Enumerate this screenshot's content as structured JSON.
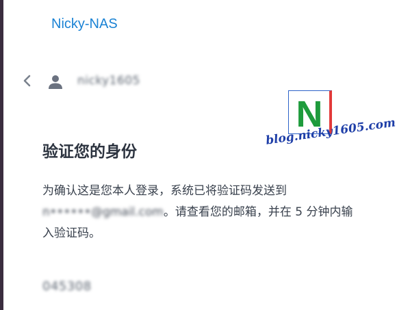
{
  "server_name": "Nicky-NAS",
  "header": {
    "back_icon": "chevron-left-icon",
    "user_icon": "user-icon",
    "username": "nicky1605"
  },
  "watermark": {
    "logo_letter": "N",
    "text": "blog.nicky1605.com",
    "colors": {
      "letter": "#1e9b3c",
      "border_left": "#2d63c8",
      "border_right": "#e23a3a",
      "text": "#1f3fa8"
    }
  },
  "title": "验证您的身份",
  "description": {
    "part1": "为确认这是您本人登录，系统已将验证码发送到",
    "email": "n••••••@gmail.com",
    "part2": "。请查看您的邮箱，并在 5 分钟内输入验证码。"
  },
  "verification_code": "045308",
  "colors": {
    "accent": "#1a82d4",
    "title": "#2d3440",
    "text": "#39414d",
    "icon": "#6b7280"
  }
}
